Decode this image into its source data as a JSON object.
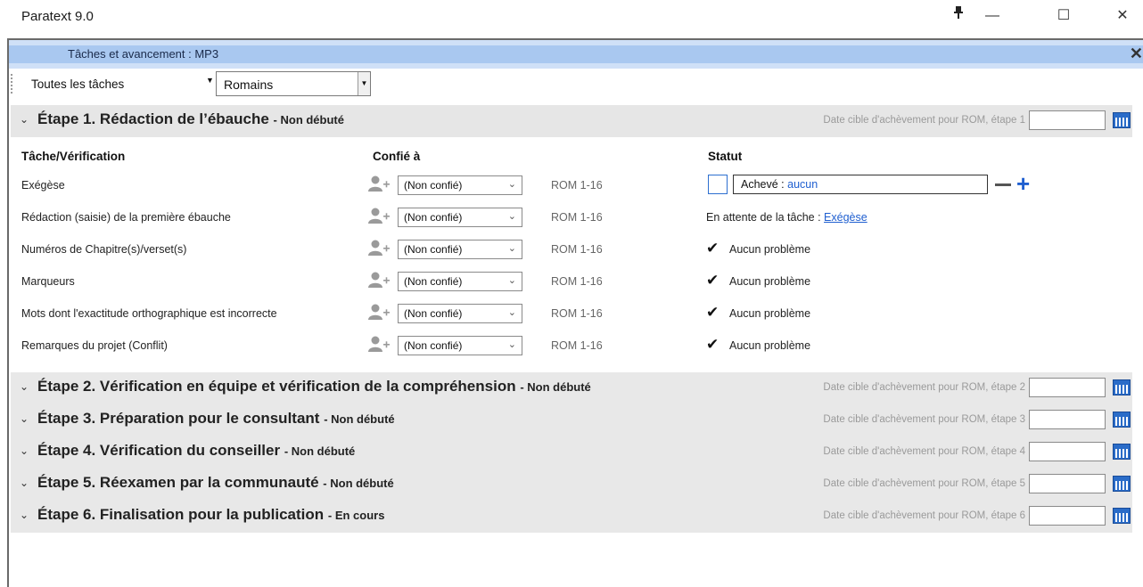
{
  "window": {
    "title": "Paratext 9.0",
    "controls": {
      "pin": "pin-icon",
      "minimize": "minimize-icon",
      "maximize": "maximize-icon",
      "close": "close-icon"
    }
  },
  "pane": {
    "title": "Tâches et avancement : MP3"
  },
  "toolbar": {
    "filter": "Toutes les tâches",
    "book": "Romains"
  },
  "columns": {
    "task": "Tâche/Vérification",
    "assigned": "Confié à",
    "status": "Statut"
  },
  "stages": [
    {
      "title": "Étape 1. Rédaction de l’ébauche",
      "status": "- Non débuté",
      "date_label": "Date cible d'achèvement pour ROM, étape 1",
      "date": ""
    },
    {
      "title": "Étape 2. Vérification en équipe et vérification de la compréhension",
      "status": "- Non débuté",
      "date_label": "Date cible d'achèvement pour ROM, étape 2",
      "date": ""
    },
    {
      "title": "Étape 3. Préparation pour le consultant",
      "status": "- Non débuté",
      "date_label": "Date cible d'achèvement pour ROM, étape 3",
      "date": ""
    },
    {
      "title": "Étape 4. Vérification du conseiller",
      "status": "- Non débuté",
      "date_label": "Date cible d'achèvement pour ROM, étape 4",
      "date": ""
    },
    {
      "title": "Étape 5. Réexamen par la communauté",
      "status": "- Non débuté",
      "date_label": "Date cible d'achèvement pour ROM, étape 5",
      "date": ""
    },
    {
      "title": "Étape 6. Finalisation pour la publication",
      "status": "- En cours",
      "date_label": "Date cible d'achèvement pour ROM, étape 6",
      "date": ""
    }
  ],
  "tasks": [
    {
      "name": "Exégèse",
      "assigned": "(Non confié)",
      "scope": "ROM 1-16",
      "status_prefix": "Achevé : ",
      "status_link": "aucun"
    },
    {
      "name": "Rédaction (saisie) de la première ébauche",
      "assigned": "(Non confié)",
      "scope": "ROM 1-16",
      "status_prefix": "En attente de la tâche : ",
      "status_link": "Exégèse"
    },
    {
      "name": "Numéros de Chapitre(s)/verset(s)",
      "assigned": "(Non confié)",
      "scope": "ROM 1-16",
      "status": "Aucun problème"
    },
    {
      "name": "Marqueurs",
      "assigned": "(Non confié)",
      "scope": "ROM 1-16",
      "status": "Aucun problème"
    },
    {
      "name": "Mots dont l'exactitude orthographique est incorrecte",
      "assigned": "(Non confié)",
      "scope": "ROM 1-16",
      "status": "Aucun problème"
    },
    {
      "name": "Remarques du projet (Conflit)",
      "assigned": "(Non confié)",
      "scope": "ROM 1-16",
      "status": "Aucun problème"
    }
  ]
}
